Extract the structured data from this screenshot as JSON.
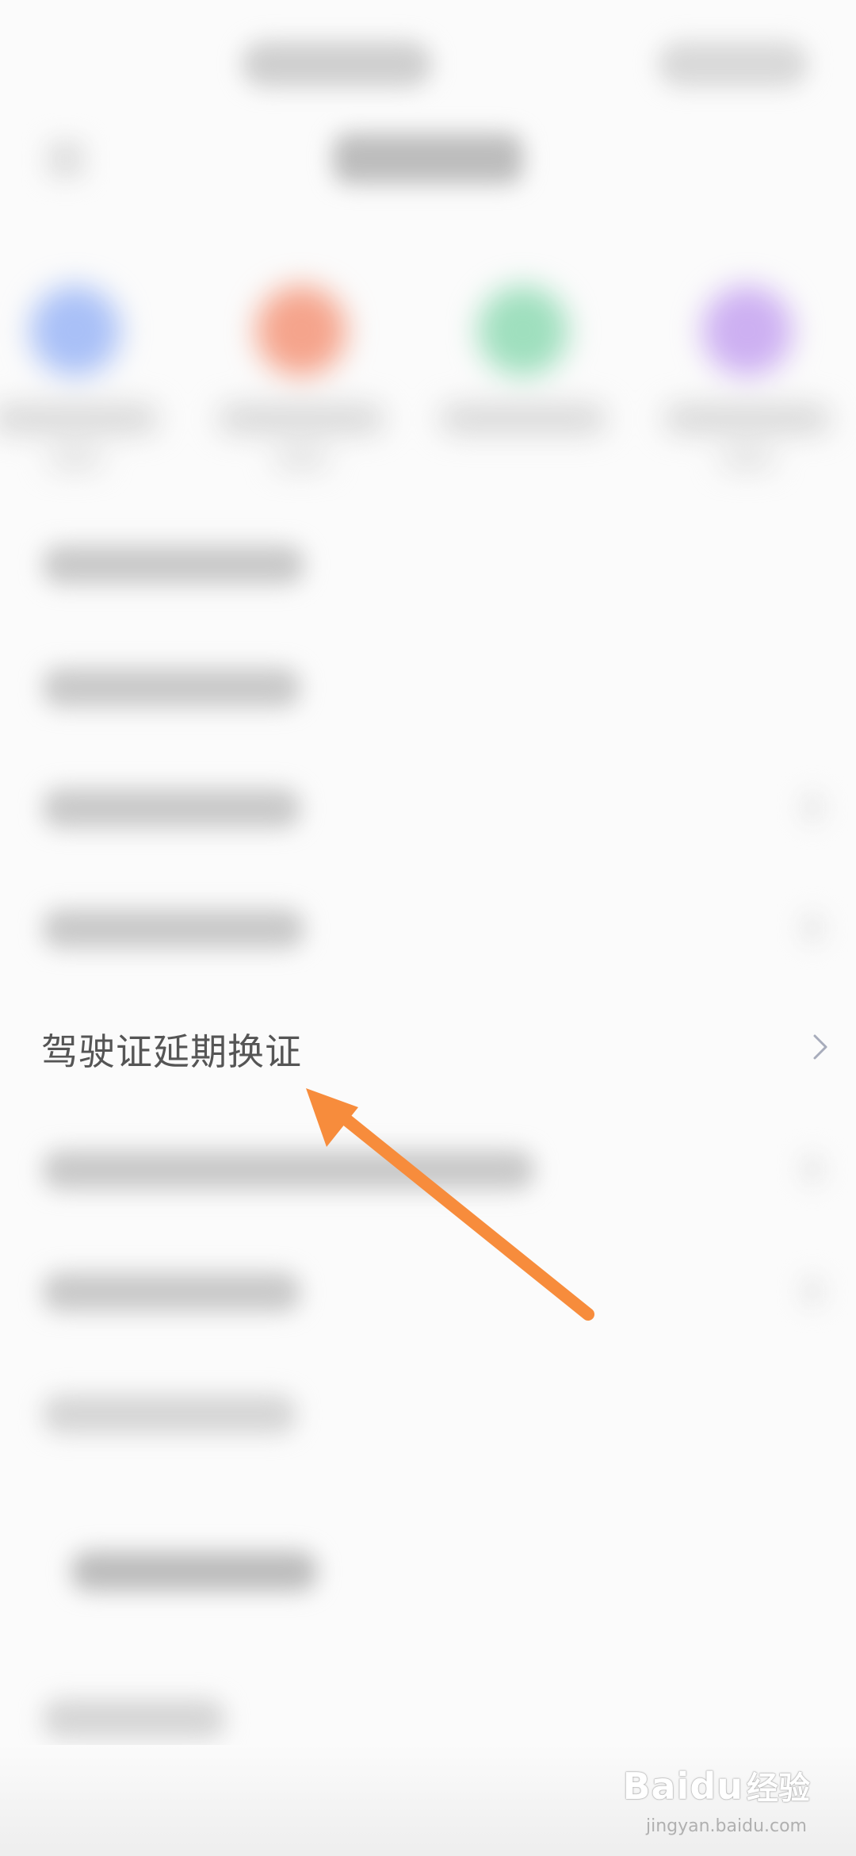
{
  "list": {
    "highlighted_item": "驾驶证延期换证"
  },
  "services": {
    "icon_colors": [
      "#a9c0f7",
      "#f5a48c",
      "#9fdfbe",
      "#cdb0f2"
    ]
  },
  "annotation": {
    "arrow_color": "#f78c3c"
  },
  "watermark": {
    "brand": "Baidu",
    "suffix": "经验",
    "url": "jingyan.baidu.com"
  }
}
